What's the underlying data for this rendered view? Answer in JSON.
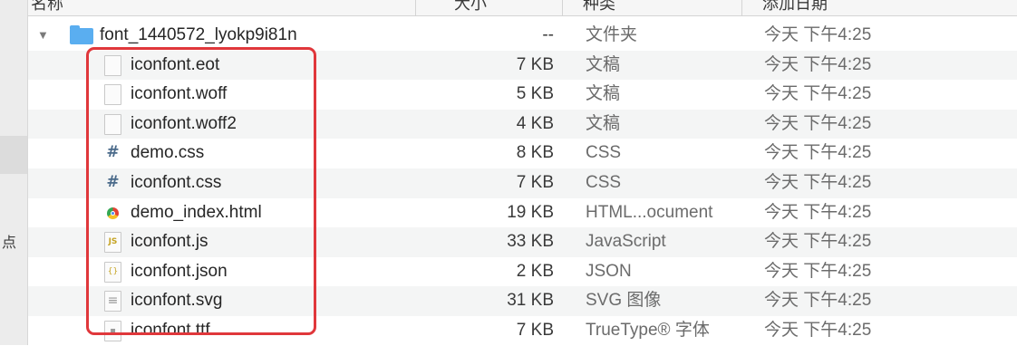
{
  "columns": {
    "name": "名称",
    "size": "大小",
    "kind": "种类",
    "date": "添加日期"
  },
  "sidebar": {
    "fragment": "点"
  },
  "folder": {
    "name": "font_1440572_lyokp9i81n",
    "size": "--",
    "kind": "文件夹",
    "date": "今天 下午4:25",
    "disclosure": "▼"
  },
  "files": [
    {
      "name": "iconfont.eot",
      "size": "7 KB",
      "kind": "文稿",
      "date": "今天 下午4:25",
      "icon": "document-icon"
    },
    {
      "name": "iconfont.woff",
      "size": "5 KB",
      "kind": "文稿",
      "date": "今天 下午4:25",
      "icon": "document-icon"
    },
    {
      "name": "iconfont.woff2",
      "size": "4 KB",
      "kind": "文稿",
      "date": "今天 下午4:25",
      "icon": "document-icon"
    },
    {
      "name": "demo.css",
      "size": "8 KB",
      "kind": "CSS",
      "date": "今天 下午4:25",
      "icon": "css-hash-icon",
      "glyph": "#"
    },
    {
      "name": "iconfont.css",
      "size": "7 KB",
      "kind": "CSS",
      "date": "今天 下午4:25",
      "icon": "css-hash-icon",
      "glyph": "#"
    },
    {
      "name": "demo_index.html",
      "size": "19 KB",
      "kind": "HTML...ocument",
      "date": "今天 下午4:25",
      "icon": "chrome-icon"
    },
    {
      "name": "iconfont.js",
      "size": "33 KB",
      "kind": "JavaScript",
      "date": "今天 下午4:25",
      "icon": "javascript-file-icon",
      "glyph": "JS"
    },
    {
      "name": "iconfont.json",
      "size": "2 KB",
      "kind": "JSON",
      "date": "今天 下午4:25",
      "icon": "json-file-icon",
      "glyph": "{}"
    },
    {
      "name": "iconfont.svg",
      "size": "31 KB",
      "kind": "SVG 图像",
      "date": "今天 下午4:25",
      "icon": "svg-file-icon",
      "glyph": "≡"
    },
    {
      "name": "iconfont.ttf",
      "size": "7 KB",
      "kind": "TrueType® 字体",
      "date": "今天 下午4:25",
      "icon": "font-file-icon",
      "glyph": "▪"
    }
  ],
  "colors": {
    "highlight": "#e0373b",
    "folder": "#5aaef0",
    "row_alt": "#f4f5f5"
  }
}
